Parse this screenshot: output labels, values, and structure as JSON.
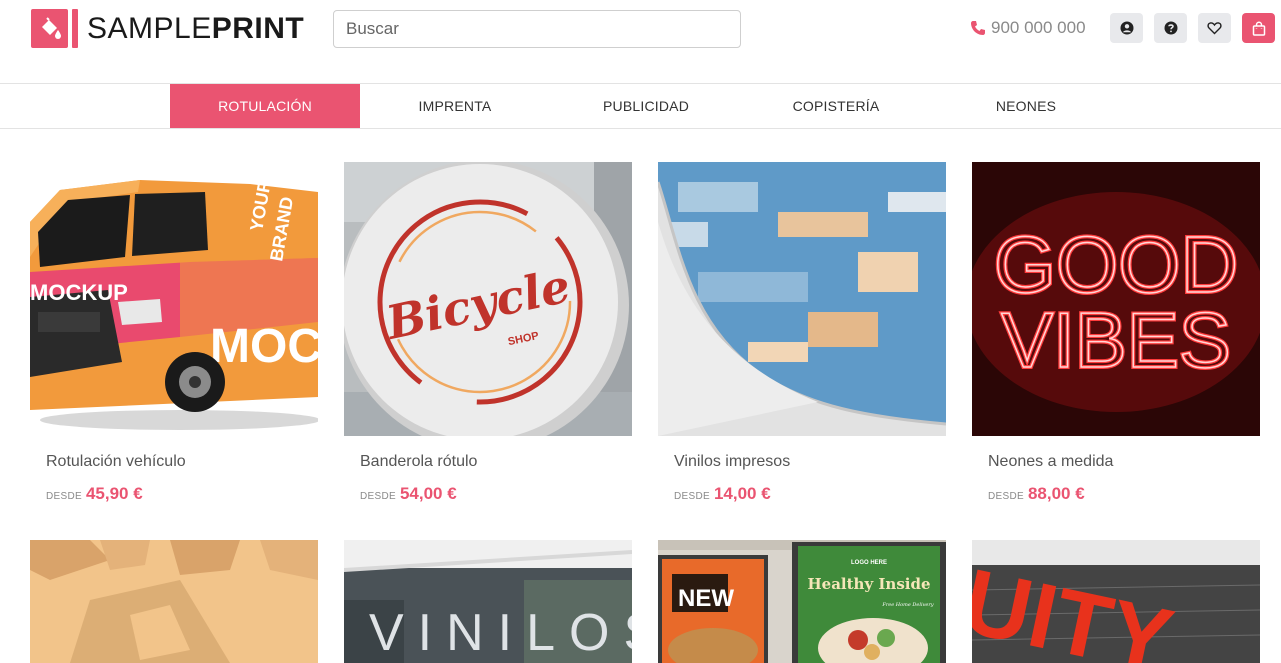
{
  "header": {
    "logo": {
      "light": "SAMPLE",
      "bold": "PRINT"
    },
    "search_placeholder": "Buscar",
    "phone": "900 000 000",
    "icons": [
      "user-icon",
      "help-icon",
      "heart-icon",
      "shopping-bag-icon"
    ]
  },
  "nav": {
    "items": [
      {
        "label": "ROTULACIÓN",
        "active": true
      },
      {
        "label": "IMPRENTA",
        "active": false
      },
      {
        "label": "PUBLICIDAD",
        "active": false
      },
      {
        "label": "COPISTERÍA",
        "active": false
      },
      {
        "label": "NEONES",
        "active": false
      }
    ]
  },
  "products": [
    {
      "title": "Rotulación vehículo",
      "from": "DESDE",
      "price": "45,90 €",
      "image_text": [
        "YOUR",
        "BRAND",
        "MOCKUP"
      ]
    },
    {
      "title": "Banderola rótulo",
      "from": "DESDE",
      "price": "54,00 €",
      "image_text": [
        "Bicycle",
        "SHOP"
      ]
    },
    {
      "title": "Vinilos impresos",
      "from": "DESDE",
      "price": "14,00 €"
    },
    {
      "title": "Neones a medida",
      "from": "DESDE",
      "price": "88,00 €",
      "image_text": [
        "GOOD",
        "VIBES"
      ]
    }
  ],
  "products_row2_image_text": {
    "window": "VINILOS",
    "poster_left": "NEW",
    "poster_right_logo": "LOGO HERE",
    "poster_right_title": "Healthy Inside",
    "poster_right_sub": "Free Home Delivery",
    "letters": "UITY"
  },
  "colors": {
    "accent": "#ea5471",
    "icon_bg": "#e8e9ec",
    "text": "#555555"
  }
}
